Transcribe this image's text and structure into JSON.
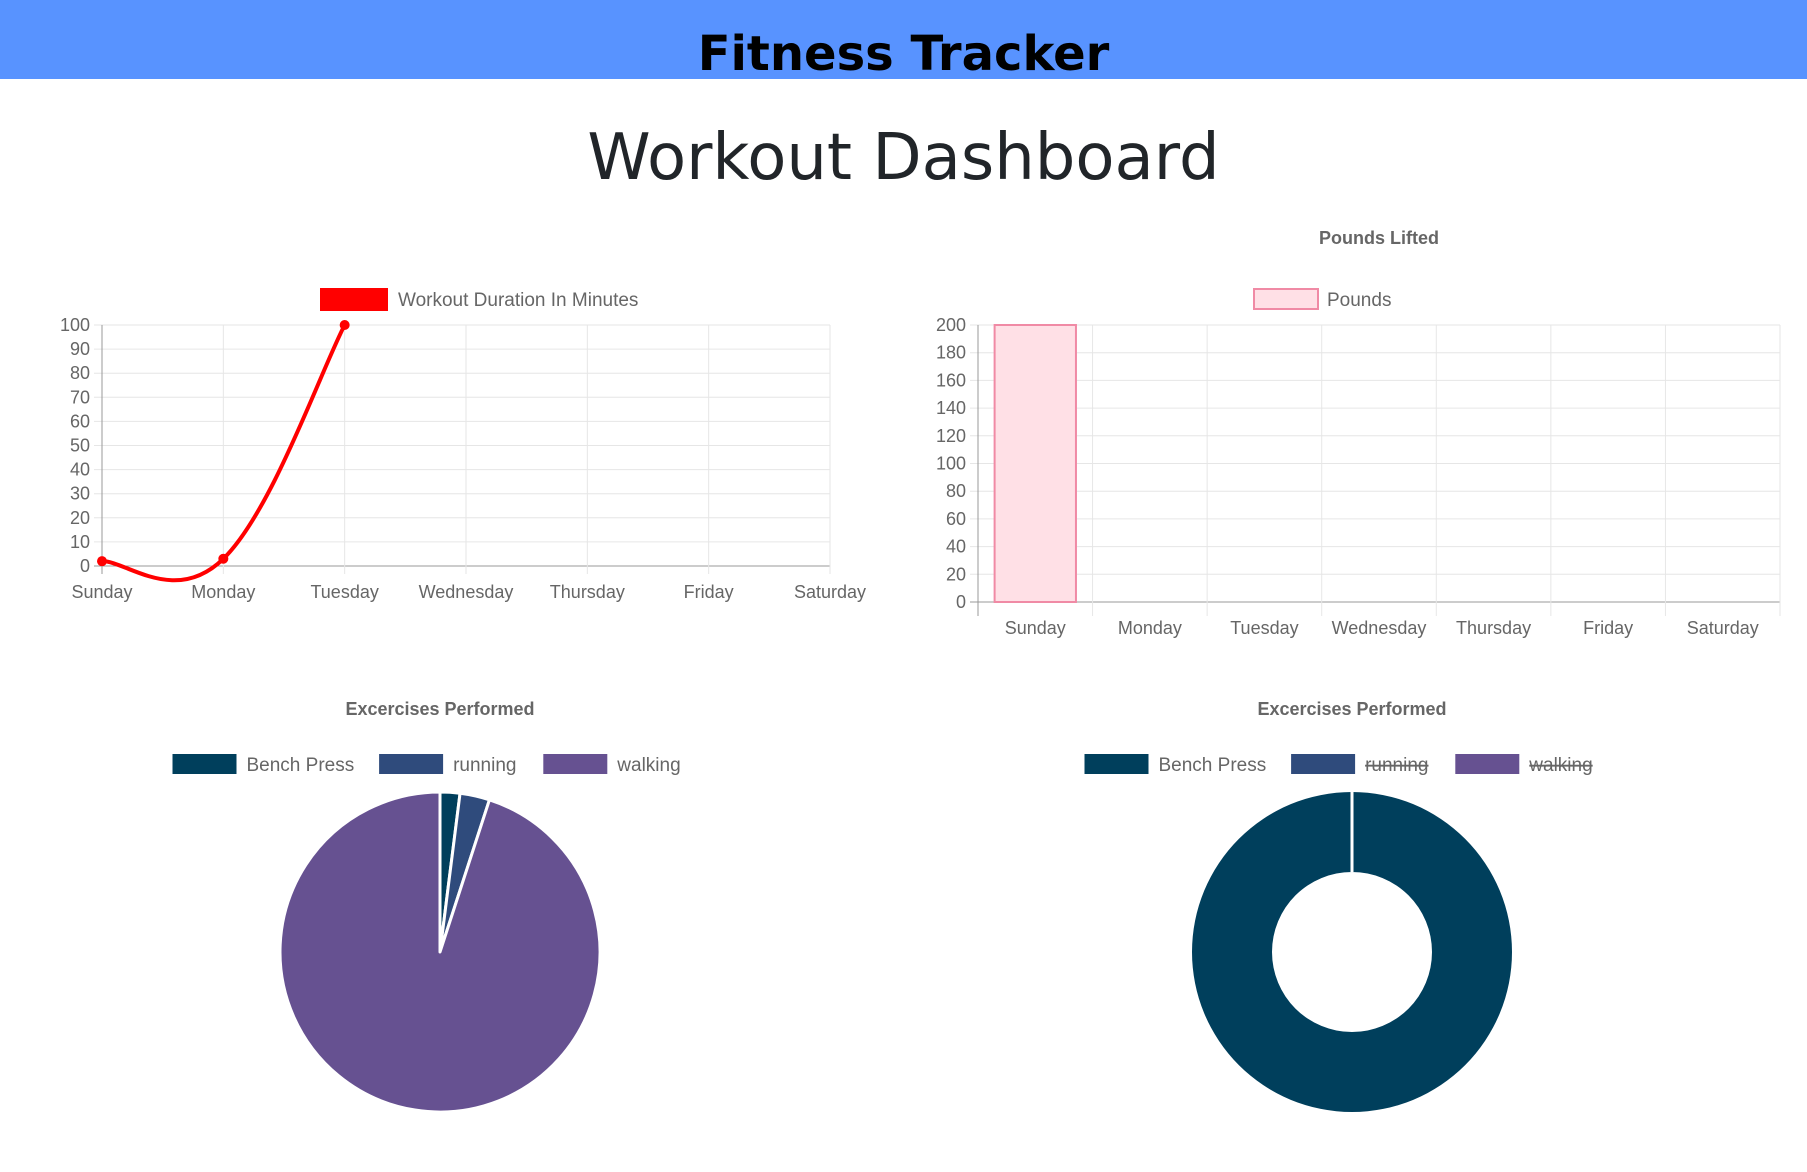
{
  "navbar": {
    "brand": "Fitness Tracker",
    "color": "#5893ff"
  },
  "page": {
    "title": "Workout Dashboard"
  },
  "chart_data": [
    {
      "type": "line",
      "title": "",
      "categories": [
        "Sunday",
        "Monday",
        "Tuesday",
        "Wednesday",
        "Thursday",
        "Friday",
        "Saturday"
      ],
      "series": [
        {
          "name": "Workout Duration In Minutes",
          "values": [
            2,
            3,
            100
          ],
          "color": "#ff0000"
        }
      ],
      "y_ticks": [
        0,
        10,
        20,
        30,
        40,
        50,
        60,
        70,
        80,
        90,
        100
      ],
      "ylim": [
        0,
        100
      ],
      "grid": true,
      "legend": "top"
    },
    {
      "type": "bar",
      "title": "Pounds Lifted",
      "categories": [
        "Sunday",
        "Monday",
        "Tuesday",
        "Wednesday",
        "Thursday",
        "Friday",
        "Saturday"
      ],
      "series": [
        {
          "name": "Pounds",
          "values": [
            200
          ],
          "color": "#ffe0e6",
          "border": "#f08aa5"
        }
      ],
      "y_ticks": [
        0,
        20,
        40,
        60,
        80,
        100,
        120,
        140,
        160,
        180,
        200
      ],
      "ylim": [
        0,
        200
      ],
      "grid": true,
      "legend": "top"
    },
    {
      "type": "pie",
      "title": "Excercises Performed",
      "labels": [
        "Bench Press",
        "running",
        "walking"
      ],
      "values": [
        2,
        3,
        95
      ],
      "colors": [
        "#003f5c",
        "#2f4b7c",
        "#665191"
      ],
      "hidden": [
        false,
        false,
        false
      ],
      "legend": "top"
    },
    {
      "type": "pie",
      "subtype": "doughnut",
      "title": "Excercises Performed",
      "labels": [
        "Bench Press",
        "running",
        "walking"
      ],
      "values": [
        200
      ],
      "colors": [
        "#003f5c",
        "#2f4b7c",
        "#665191"
      ],
      "hidden": [
        false,
        true,
        true
      ],
      "legend": "top"
    }
  ]
}
